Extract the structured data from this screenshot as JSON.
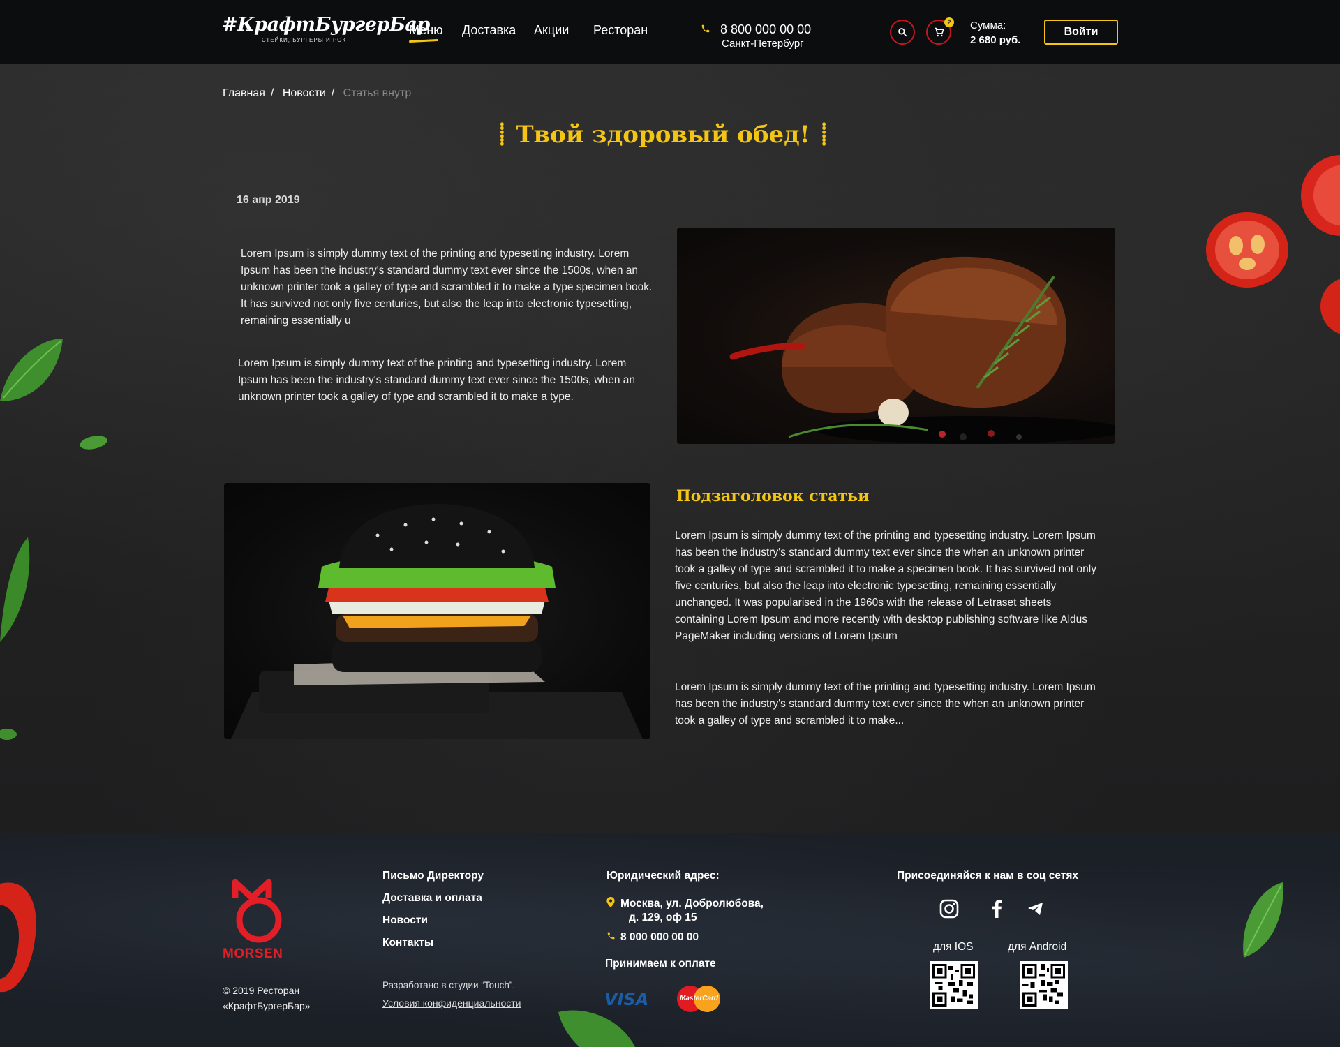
{
  "header": {
    "logo_main": "#КрафтБургерБар",
    "logo_sub": "· СТЕЙКИ, БУРГЕРЫ И РОК ·",
    "nav": [
      {
        "label": "Меню"
      },
      {
        "label": "Доставка"
      },
      {
        "label": "Акции"
      },
      {
        "label": "Ресторан"
      }
    ],
    "phone": "8 800 000 00 00",
    "city": "Санкт-Петербург",
    "cart_count": "2",
    "sum_label": "Сумма:",
    "sum_amount": "2 680 руб.",
    "login_label": "Войти",
    "colors": {
      "accent": "#f5c514",
      "danger": "#c8141c",
      "bg": "#0c0d0f"
    }
  },
  "breadcrumb": {
    "items": [
      "Главная",
      "Новости",
      "Статья внутр"
    ],
    "separator": "/"
  },
  "article": {
    "title": "Твой здоровый обед!",
    "date": "16 апр 2019",
    "paragraph_1": "Lorem Ipsum is simply dummy text of the printing and typesetting industry. Lorem Ipsum has been the industry's standard dummy text ever since the 1500s, when an unknown printer took a galley of type and scrambled it to make a type specimen book. It has survived not only five centuries, but also the leap into electronic typesetting, remaining essentially u",
    "paragraph_2": "Lorem Ipsum is simply dummy text of the printing and typesetting industry. Lorem Ipsum has been the industry's standard dummy text ever since the 1500s, when an unknown printer took a galley of type and scrambled it to make a type.",
    "subtitle": "Подзаголовок статьи",
    "paragraph_3": "Lorem Ipsum is simply dummy text of the printing and typesetting industry. Lorem Ipsum has been the industry's standard dummy text ever since the when an unknown printer took a galley of type and scrambled it to make a specimen book. It has survived not only five centuries, but also the leap into electronic typesetting, remaining essentially unchanged. It was popularised in the 1960s with the release of Letraset sheets containing Lorem Ipsum and more recently with desktop publishing software like Aldus PageMaker including versions of Lorem Ipsum",
    "paragraph_4": "Lorem Ipsum is simply dummy text of the printing and typesetting industry. Lorem Ipsum has been the industry's standard dummy text ever since the when an unknown printer took a galley of type and scrambled it to make..."
  },
  "footer": {
    "brand": "MORSEN",
    "copyright_line1": "© 2019 Ресторан",
    "copyright_line2": "«КрафтБургерБар»",
    "links": [
      "Письмо Директору",
      "Доставка и оплата",
      "Новости",
      "Контакты"
    ],
    "studio": "Разработано в студии “Touch”.",
    "privacy": "Условия конфиденциальности",
    "legal_title": "Юридический адрес:",
    "address_line1": "Москва, ул. Добролюбова,",
    "address_line2": "д. 129, оф 15",
    "phone": "8 000 000 00 00",
    "payment_title": "Принимаем к оплате",
    "payment_visa": "VISA",
    "payment_mc": "MasterCard",
    "social_title": "Присоединяйся к нам в соц сетях",
    "social_icons": [
      "instagram-icon",
      "facebook-icon",
      "telegram-icon"
    ],
    "app_ios": "для IOS",
    "app_android": "для Android"
  }
}
